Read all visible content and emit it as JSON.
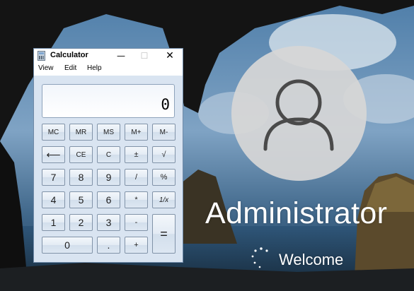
{
  "lock_screen": {
    "username": "Administrator",
    "status": "Welcome"
  },
  "calculator": {
    "title": "Calculator",
    "menu": [
      "View",
      "Edit",
      "Help"
    ],
    "display": "0",
    "window_controls": {
      "minimize": "—",
      "maximize": "☐",
      "close": "✕"
    },
    "keys": {
      "mc": "MC",
      "mr": "MR",
      "ms": "MS",
      "mplus": "M+",
      "mminus": "M-",
      "backspace": "⟵",
      "ce": "CE",
      "c": "C",
      "plusminus": "±",
      "sqrt": "√",
      "seven": "7",
      "eight": "8",
      "nine": "9",
      "divide": "/",
      "percent": "%",
      "four": "4",
      "five": "5",
      "six": "6",
      "multiply": "*",
      "reciprocal": "1/x",
      "one": "1",
      "two": "2",
      "three": "3",
      "minus": "-",
      "equals": "=",
      "zero": "0",
      "decimal": ".",
      "plus": "+"
    }
  },
  "colors": {
    "sky": "#6a8fb5",
    "cave": "#141414",
    "window_frame": "#6f8aa8",
    "calc_body": "#d9e4f1"
  }
}
